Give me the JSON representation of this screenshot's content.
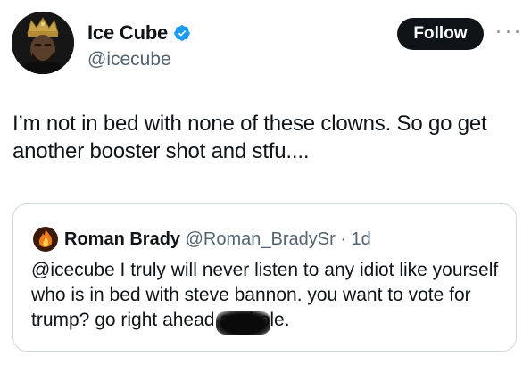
{
  "author": {
    "display_name": "Ice Cube",
    "handle": "@icecube",
    "verified": true,
    "avatar_icon": "king-crown-avatar-icon"
  },
  "actions": {
    "follow_label": "Follow",
    "more_icon": "more-options-icon"
  },
  "tweet": {
    "text": "I’m not in bed with none of these clowns. So go get another booster shot and stfu...."
  },
  "quoted_tweet": {
    "display_name": "Roman Brady",
    "handle": "@Roman_BradySr",
    "separator": "·",
    "time": "1d",
    "text_before": "@icecube I truly will never listen to any idiot like yourself who is in bed with steve bannon. you want to vote for trump? go right ahead ",
    "censored_word": "asshole",
    "text_after": "."
  },
  "colors": {
    "follow_bg": "#0f1419",
    "handle_gray": "#536471",
    "verified_blue": "#1d9bf0",
    "border": "#cfd9de"
  }
}
